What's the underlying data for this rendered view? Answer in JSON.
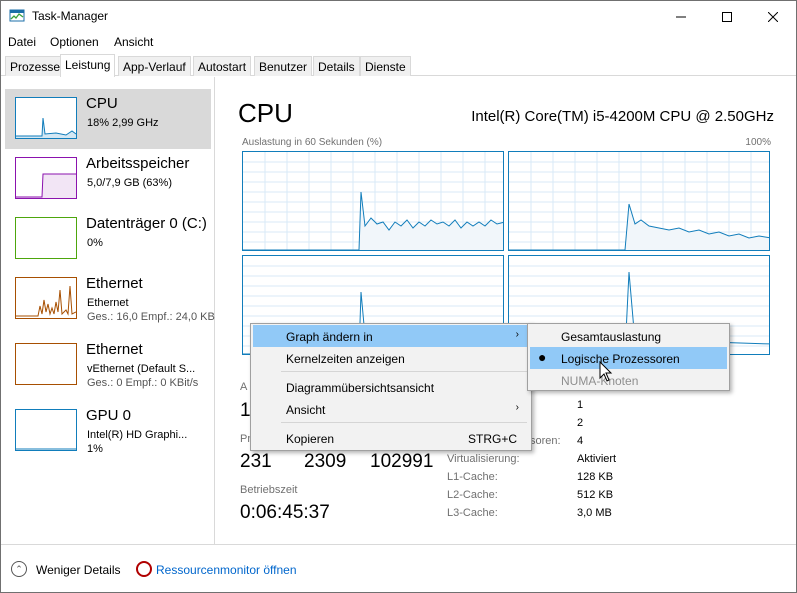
{
  "window": {
    "title": "Task-Manager"
  },
  "menu": [
    "Datei",
    "Optionen",
    "Ansicht"
  ],
  "tabs": [
    "Prozesse",
    "Leistung",
    "App-Verlauf",
    "Autostart",
    "Benutzer",
    "Details",
    "Dienste"
  ],
  "resources": [
    {
      "title": "CPU",
      "line1": "18% 2,99 GHz",
      "line2": "",
      "color": "#117dbb"
    },
    {
      "title": "Arbeitsspeicher",
      "line1": "5,0/7,9 GB (63%)",
      "line2": "",
      "color": "#8b12ae"
    },
    {
      "title": "Datenträger 0 (C:)",
      "line1": "0%",
      "line2": "",
      "color": "#4da60c"
    },
    {
      "title": "Ethernet",
      "line1": "Ethernet",
      "line2": "Ges.: 16,0 Empf.: 24,0 KB",
      "color": "#a74f01"
    },
    {
      "title": "Ethernet",
      "line1": "vEthernet (Default S...",
      "line2": "Ges.: 0 Empf.: 0 KBit/s",
      "color": "#a74f01"
    },
    {
      "title": "GPU 0",
      "line1": "Intel(R) HD Graphi...",
      "line2": "1%",
      "color": "#117dbb"
    }
  ],
  "main": {
    "title": "CPU",
    "model": "Intel(R) Core(TM) i5-4200M CPU @ 2.50GHz",
    "graph_label": "Auslastung in 60 Sekunden (%)",
    "graph_max": "100%",
    "stats": {
      "label_a": "A",
      "value_a": "1",
      "label_p": "Pr",
      "processes": "231",
      "threads": "2309",
      "handles": "102991",
      "uptime_label": "Betriebszeit",
      "uptime": "0:06:45:37"
    },
    "info": [
      {
        "label": "",
        "value": "1"
      },
      {
        "label": "",
        "value": "2"
      },
      {
        "label": "soren:",
        "value": "4"
      },
      {
        "label": "Virtualisierung:",
        "value": "Aktiviert"
      },
      {
        "label": "L1-Cache:",
        "value": "128 KB"
      },
      {
        "label": "L2-Cache:",
        "value": "512 KB"
      },
      {
        "label": "L3-Cache:",
        "value": "3,0 MB"
      }
    ]
  },
  "context_menu": {
    "items": [
      {
        "label": "Graph ändern in",
        "shortcut": "",
        "has_submenu": true
      },
      {
        "label": "Kernelzeiten anzeigen",
        "shortcut": "",
        "has_submenu": false
      },
      {
        "label": "Diagrammübersichtsansicht",
        "shortcut": "",
        "has_submenu": false
      },
      {
        "label": "Ansicht",
        "shortcut": "",
        "has_submenu": true
      },
      {
        "label": "Kopieren",
        "shortcut": "STRG+C",
        "has_submenu": false
      }
    ],
    "arrow": "›"
  },
  "submenu": {
    "items": [
      {
        "label": "Gesamtauslastung",
        "state": "normal"
      },
      {
        "label": "Logische Prozessoren",
        "state": "selected"
      },
      {
        "label": "NUMA-Knoten",
        "state": "disabled"
      }
    ],
    "bullet": "●"
  },
  "footer": {
    "fewer_details": "Weniger Details",
    "resource_monitor": "Ressourcenmonitor öffnen"
  },
  "colors": {
    "cpu": "#117dbb",
    "memory": "#8b12ae",
    "disk": "#4da60c",
    "ethernet": "#a74f01",
    "highlight": "#91c9f7",
    "link": "#0066cc"
  }
}
